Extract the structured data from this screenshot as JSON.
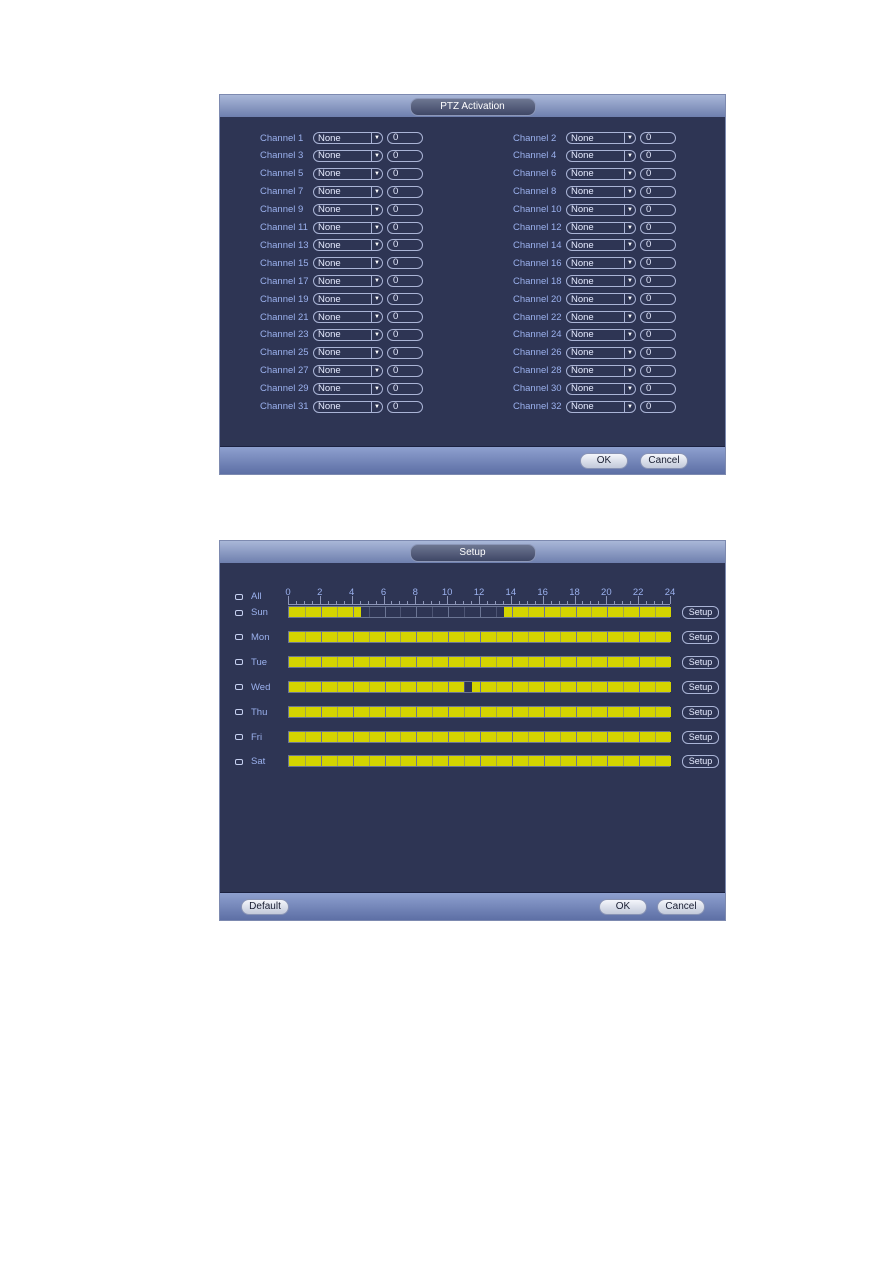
{
  "ptz": {
    "title": "PTZ Activation",
    "channels": [
      {
        "label": "Channel 1",
        "type": "None",
        "value": "0"
      },
      {
        "label": "Channel 2",
        "type": "None",
        "value": "0"
      },
      {
        "label": "Channel 3",
        "type": "None",
        "value": "0"
      },
      {
        "label": "Channel 4",
        "type": "None",
        "value": "0"
      },
      {
        "label": "Channel 5",
        "type": "None",
        "value": "0"
      },
      {
        "label": "Channel 6",
        "type": "None",
        "value": "0"
      },
      {
        "label": "Channel 7",
        "type": "None",
        "value": "0"
      },
      {
        "label": "Channel 8",
        "type": "None",
        "value": "0"
      },
      {
        "label": "Channel 9",
        "type": "None",
        "value": "0"
      },
      {
        "label": "Channel 10",
        "type": "None",
        "value": "0"
      },
      {
        "label": "Channel 11",
        "type": "None",
        "value": "0"
      },
      {
        "label": "Channel 12",
        "type": "None",
        "value": "0"
      },
      {
        "label": "Channel 13",
        "type": "None",
        "value": "0"
      },
      {
        "label": "Channel 14",
        "type": "None",
        "value": "0"
      },
      {
        "label": "Channel 15",
        "type": "None",
        "value": "0"
      },
      {
        "label": "Channel 16",
        "type": "None",
        "value": "0"
      },
      {
        "label": "Channel 17",
        "type": "None",
        "value": "0"
      },
      {
        "label": "Channel 18",
        "type": "None",
        "value": "0"
      },
      {
        "label": "Channel 19",
        "type": "None",
        "value": "0"
      },
      {
        "label": "Channel 20",
        "type": "None",
        "value": "0"
      },
      {
        "label": "Channel 21",
        "type": "None",
        "value": "0"
      },
      {
        "label": "Channel 22",
        "type": "None",
        "value": "0"
      },
      {
        "label": "Channel 23",
        "type": "None",
        "value": "0"
      },
      {
        "label": "Channel 24",
        "type": "None",
        "value": "0"
      },
      {
        "label": "Channel 25",
        "type": "None",
        "value": "0"
      },
      {
        "label": "Channel 26",
        "type": "None",
        "value": "0"
      },
      {
        "label": "Channel 27",
        "type": "None",
        "value": "0"
      },
      {
        "label": "Channel 28",
        "type": "None",
        "value": "0"
      },
      {
        "label": "Channel 29",
        "type": "None",
        "value": "0"
      },
      {
        "label": "Channel 30",
        "type": "None",
        "value": "0"
      },
      {
        "label": "Channel 31",
        "type": "None",
        "value": "0"
      },
      {
        "label": "Channel 32",
        "type": "None",
        "value": "0"
      }
    ],
    "ok_label": "OK",
    "cancel_label": "Cancel"
  },
  "setup": {
    "title": "Setup",
    "all_label": "All",
    "hour_ticks": [
      "0",
      "2",
      "4",
      "6",
      "8",
      "10",
      "12",
      "14",
      "16",
      "18",
      "20",
      "22",
      "24"
    ],
    "days": [
      {
        "label": "Sun",
        "periods": [
          [
            0,
            4.5
          ],
          [
            13.5,
            24
          ]
        ],
        "setup_label": "Setup"
      },
      {
        "label": "Mon",
        "periods": [
          [
            0,
            24
          ]
        ],
        "setup_label": "Setup"
      },
      {
        "label": "Tue",
        "periods": [
          [
            0,
            24
          ]
        ],
        "setup_label": "Setup"
      },
      {
        "label": "Wed",
        "periods": [
          [
            0,
            11
          ],
          [
            11.5,
            24
          ]
        ],
        "setup_label": "Setup"
      },
      {
        "label": "Thu",
        "periods": [
          [
            0,
            24
          ]
        ],
        "setup_label": "Setup"
      },
      {
        "label": "Fri",
        "periods": [
          [
            0,
            24
          ]
        ],
        "setup_label": "Setup"
      },
      {
        "label": "Sat",
        "periods": [
          [
            0,
            24
          ]
        ],
        "setup_label": "Setup"
      }
    ],
    "default_label": "Default",
    "ok_label": "OK",
    "cancel_label": "Cancel",
    "schedule_color": "#d4d400"
  }
}
